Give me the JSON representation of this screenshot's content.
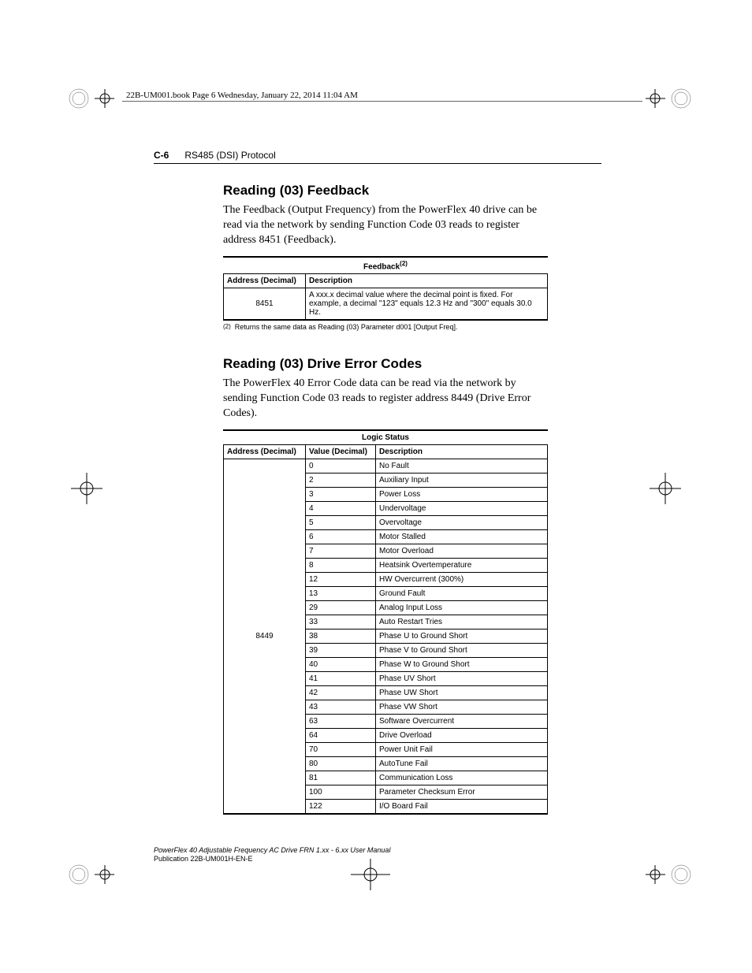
{
  "crop_header": "22B-UM001.book  Page 6  Wednesday, January 22, 2014  11:04 AM",
  "page_number": "C-6",
  "chapter_title": "RS485 (DSI) Protocol",
  "section1": {
    "heading": "Reading (03) Feedback",
    "para": "The Feedback (Output Frequency) from the PowerFlex 40 drive can be read via the network by sending Function Code 03 reads to register address 8451 (Feedback).",
    "table": {
      "caption": "Feedback",
      "caption_sup": "(2)",
      "head": [
        "Address (Decimal)",
        "Description"
      ],
      "addr": "8451",
      "desc": "A xxx.x decimal value where the decimal point is fixed. For example, a decimal \"123\" equals 12.3 Hz and \"300\" equals 30.0 Hz."
    },
    "footnote_sup": "(2)",
    "footnote": "Returns the same data as Reading (03) Parameter d001 [Output Freq]."
  },
  "section2": {
    "heading": "Reading (03) Drive Error Codes",
    "para": "The PowerFlex 40 Error Code data can be read via the network by sending Function Code 03 reads to register address 8449 (Drive Error Codes).",
    "table": {
      "caption": "Logic Status",
      "head": [
        "Address (Decimal)",
        "Value (Decimal)",
        "Description"
      ],
      "addr": "8449",
      "rows": [
        [
          "0",
          "No Fault"
        ],
        [
          "2",
          "Auxiliary Input"
        ],
        [
          "3",
          "Power Loss"
        ],
        [
          "4",
          "Undervoltage"
        ],
        [
          "5",
          "Overvoltage"
        ],
        [
          "6",
          "Motor Stalled"
        ],
        [
          "7",
          "Motor Overload"
        ],
        [
          "8",
          "Heatsink Overtemperature"
        ],
        [
          "12",
          "HW Overcurrent (300%)"
        ],
        [
          "13",
          "Ground Fault"
        ],
        [
          "29",
          "Analog Input Loss"
        ],
        [
          "33",
          "Auto Restart Tries"
        ],
        [
          "38",
          "Phase U to Ground Short"
        ],
        [
          "39",
          "Phase V to Ground Short"
        ],
        [
          "40",
          "Phase W to Ground Short"
        ],
        [
          "41",
          "Phase UV Short"
        ],
        [
          "42",
          "Phase UW Short"
        ],
        [
          "43",
          "Phase VW Short"
        ],
        [
          "63",
          "Software Overcurrent"
        ],
        [
          "64",
          "Drive Overload"
        ],
        [
          "70",
          "Power Unit Fail"
        ],
        [
          "80",
          "AutoTune Fail"
        ],
        [
          "81",
          "Communication Loss"
        ],
        [
          "100",
          "Parameter Checksum Error"
        ],
        [
          "122",
          "I/O Board Fail"
        ]
      ]
    }
  },
  "footer": {
    "line1": "PowerFlex 40 Adjustable Frequency AC Drive FRN 1.xx - 6.xx User Manual",
    "line2": "Publication 22B-UM001H-EN-E"
  }
}
